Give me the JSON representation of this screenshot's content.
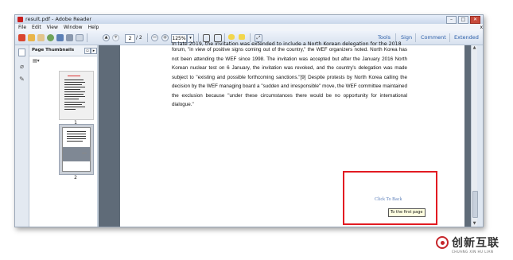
{
  "window": {
    "title": "result.pdf - Adobe Reader",
    "controls": [
      "–",
      "□",
      "✕"
    ]
  },
  "menu": {
    "items": [
      "File",
      "Edit",
      "View",
      "Window",
      "Help"
    ],
    "close": "x"
  },
  "toolbar": {
    "current_page": "2",
    "page_total": "/ 2",
    "zoom": "125%",
    "zoom_dropdown": "▾",
    "links": [
      "Tools",
      "Sign",
      "Comment",
      "Extended"
    ],
    "icons": [
      "create-pdf-icon",
      "open-icon",
      "edit-icon",
      "cloud-icon",
      "save-icon",
      "print-icon",
      "email-icon",
      "prev-page-icon",
      "next-page-icon",
      "zoom-out-icon",
      "zoom-in-icon",
      "fit-page-icon",
      "fit-width-icon",
      "comment-icon",
      "highlight-icon",
      "read-mode-icon"
    ]
  },
  "sidebar": {
    "panel_title": "Page Thumbnails",
    "thumbnails": [
      {
        "label": "1"
      },
      {
        "label": "2"
      }
    ]
  },
  "document": {
    "cut_line": "In late 2019, the invitation was extended to include a North Korean delegation for the 2018",
    "paragraph": "forum, \"in view of positive signs coming out of the country,\" the WEF organizers noted. North Korea has not been attending the WEF since 1998. The invitation was accepted but after the January 2016 North Korean nuclear test on 6 January, the invitation was revoked, and the country's delegation was made subject to \"existing and possible forthcoming sanctions.\"[9] Despite protests by North Korea calling the decision by the WEF managing board a \"sudden and irresponsible\" move, the WEF committee maintained the exclusion because \"under these circumstances there would be no opportunity for international dialogue.\"",
    "back_link": "Click To Back",
    "tooltip": "To the first page"
  },
  "watermark": {
    "text": "创新互联",
    "subtext": "CHUANG XIN HU LIAN"
  },
  "colors": {
    "highlight": "#e21b22",
    "link": "#2a5da8",
    "doc_background": "#5f6b78"
  }
}
